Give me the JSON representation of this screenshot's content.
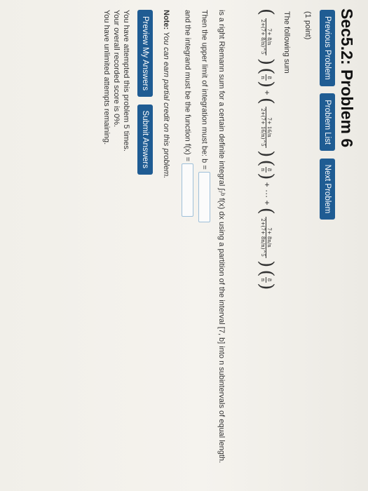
{
  "header": {
    "title": "Sec5.2: Problem 6"
  },
  "nav": {
    "previous": "Previous Problem",
    "list": "Problem List",
    "next": "Next Problem"
  },
  "problem": {
    "points": "(1 point)",
    "intro": "The following sum",
    "term1_num": "7+ 8/n",
    "term1_den": "2+(7+ 8/n)^5",
    "term2_num": "7+ 16/n",
    "term2_den": "2+(7+ 16/n)^5",
    "termn_num": "7+ 8n/n",
    "termn_den": "2+(7+ 8n/n)^5",
    "factor": "8/n",
    "plus": "+",
    "dots": "+ ··· +",
    "riemann": "is a right Riemann sum for a certain definite integral ∫₇ᵇ f(x) dx using a partition of the interval [7, b] into n subintervals of equal length.",
    "upper_limit": "Then the upper limit of integration must be: b =",
    "integrand": "and the integrand must be the function f(x) ="
  },
  "note": {
    "label": "Note:",
    "text": "You can earn partial credit on this problem."
  },
  "actions": {
    "preview": "Preview My Answers",
    "submit": "Submit Answers"
  },
  "status": {
    "attempts": "You have attempted this problem 5 times.",
    "score": "Your overall recorded score is 0%.",
    "remaining": "You have unlimited attempts remaining."
  }
}
